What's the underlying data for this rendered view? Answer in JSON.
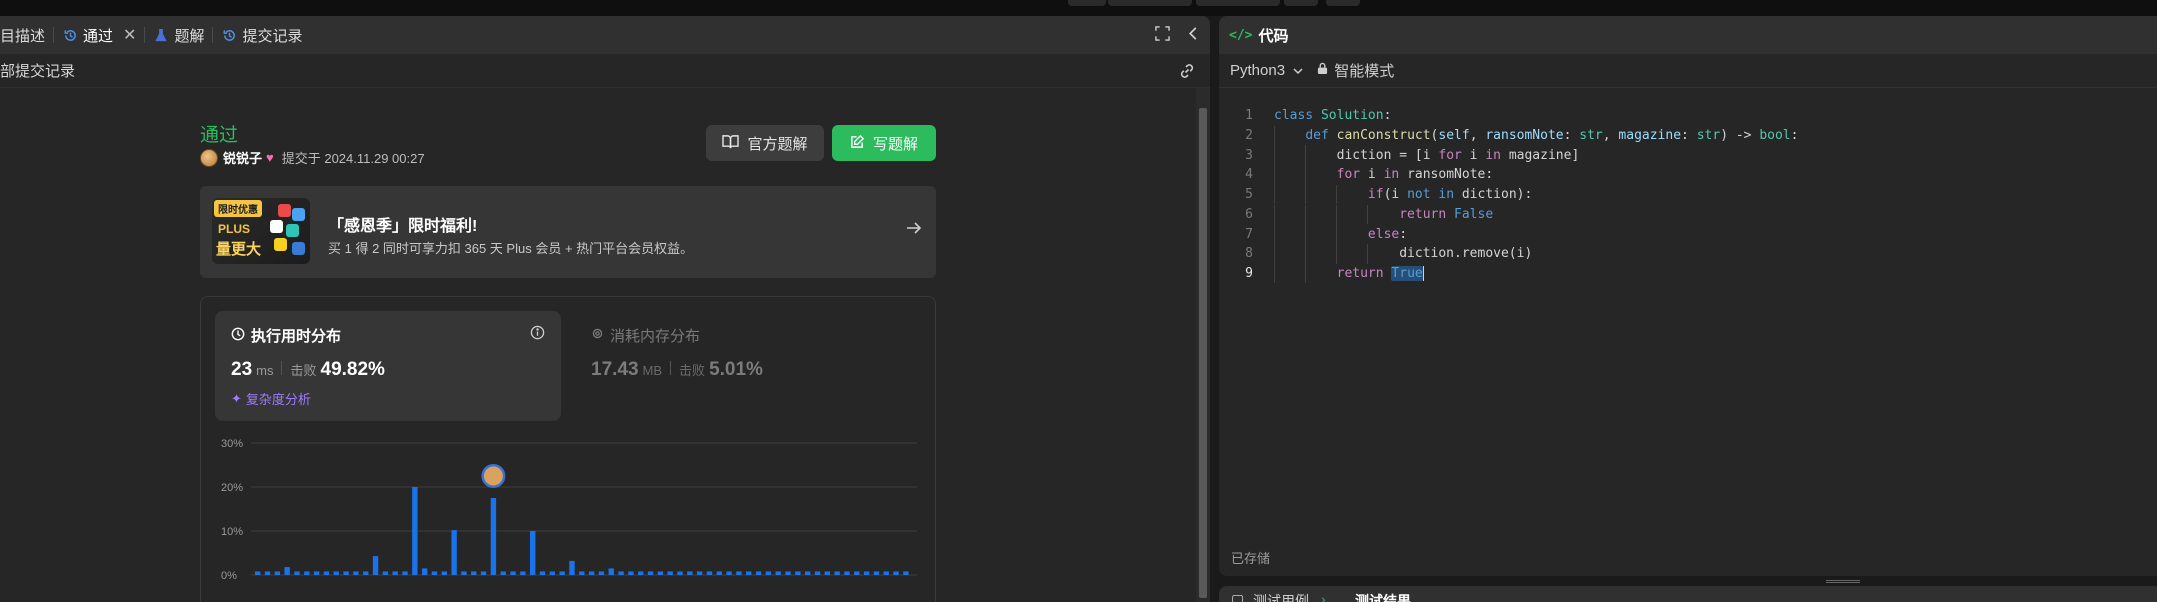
{
  "left_tabs": {
    "description": "目描述",
    "accepted": "通过",
    "solutions": "题解",
    "submissions": "提交记录"
  },
  "subbar": {
    "all_submissions": "部提交记录"
  },
  "result": {
    "status": "通过",
    "username": "锐锐子",
    "submitted_at": "提交于 2024.11.29 00:27",
    "official_solution_btn": "官方题解",
    "write_solution_btn": "写题解"
  },
  "promo": {
    "badge": "限时优惠",
    "plus": "PLUS",
    "big_text": "量更大",
    "title": "「感恩季」限时福利!",
    "desc": "买 1 得 2 同时可享力扣 365 天 Plus 会员 + 热门平台会员权益。"
  },
  "runtime": {
    "title": "执行用时分布",
    "value": "23",
    "unit": "ms",
    "beats_label": "击败",
    "beats": "49.82%",
    "complexity_link": "复杂度分析"
  },
  "memory": {
    "title": "消耗内存分布",
    "value": "17.43",
    "unit": "MB",
    "beats_label": "击败",
    "beats": "5.01%"
  },
  "chart_data": {
    "type": "bar",
    "title": "",
    "xlabel": "",
    "ylabel": "",
    "ylim": [
      0,
      30
    ],
    "y_ticks": [
      "30%",
      "20%",
      "10%",
      "0%"
    ],
    "grid": true,
    "values": [
      0.8,
      0.8,
      0.8,
      1.8,
      0.8,
      0.8,
      0.8,
      0.8,
      0.8,
      0.8,
      0.8,
      0.8,
      4.3,
      0.8,
      0.8,
      0.8,
      20,
      1.5,
      0.8,
      0.8,
      10.2,
      0.8,
      0.8,
      0.8,
      17.5,
      0.8,
      0.8,
      0.8,
      10,
      0.8,
      0.8,
      0.8,
      3.2,
      0.8,
      0.8,
      0.8,
      1.5,
      0.8,
      0.8,
      0.8,
      0.8,
      0.8,
      0.8,
      0.8,
      0.8,
      0.8,
      0.8,
      0.8,
      0.8,
      0.8,
      0.8,
      0.8,
      0.8,
      0.8,
      0.8,
      0.8,
      0.8,
      0.8,
      0.8,
      0.8,
      0.8,
      0.8,
      0.8,
      0.8,
      0.8,
      0.8,
      0.8
    ],
    "highlight_index": 24,
    "bar_color": "#1a73e8"
  },
  "code_panel": {
    "title": "代码",
    "language": "Python3",
    "mode": "智能模式",
    "saved": "已存储",
    "lines": [
      "class Solution:",
      "    def canConstruct(self, ransomNote: str, magazine: str) -> bool:",
      "        diction = [i for i in magazine]",
      "        for i in ransomNote:",
      "            if(i not in diction):",
      "                return False",
      "            else:",
      "                diction.remove(i)",
      "        return True"
    ]
  },
  "bottom_panel": {
    "testcase": "测试用例",
    "result": "测试结果"
  },
  "colors": {
    "accent_green": "#2cbb5d",
    "bar_blue": "#1a73e8",
    "link_purple": "#9c7bff"
  }
}
